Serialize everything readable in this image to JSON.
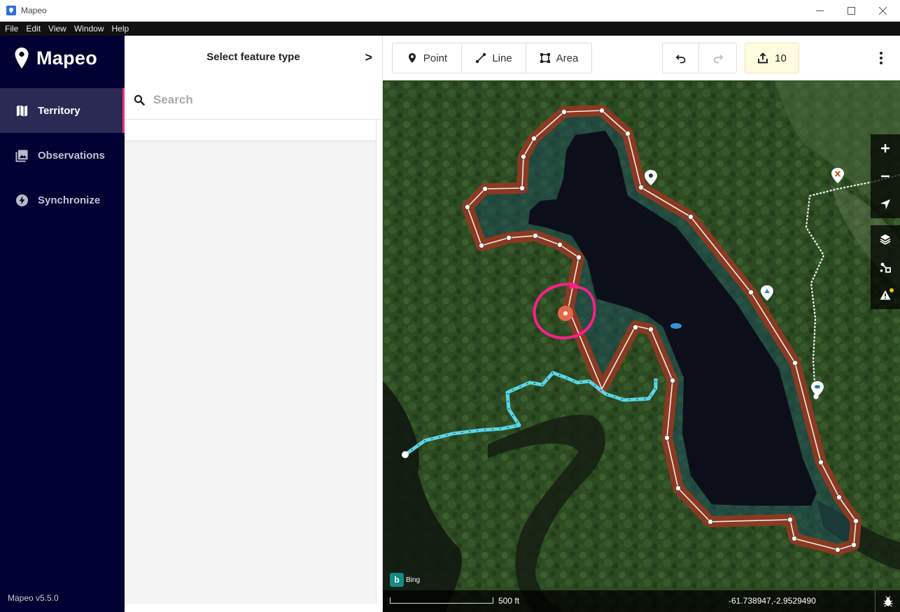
{
  "window": {
    "title": "Mapeo"
  },
  "menu": [
    "File",
    "Edit",
    "View",
    "Window",
    "Help"
  ],
  "sidebar": {
    "logo": "Mapeo",
    "items": [
      {
        "label": "Territory",
        "icon": "map-icon",
        "active": true
      },
      {
        "label": "Observations",
        "icon": "photos-icon",
        "active": false
      },
      {
        "label": "Synchronize",
        "icon": "bolt-icon",
        "active": false
      }
    ],
    "version": "Mapeo v5.5.0"
  },
  "panel": {
    "title": "Select feature type",
    "next": ">",
    "search_placeholder": "Search"
  },
  "toolbar": {
    "point": "Point",
    "line": "Line",
    "area": "Area",
    "sync_count": "10"
  },
  "map": {
    "attribution": "Bing",
    "scale_label": "500 ft",
    "coordinates": "-61.738947,-2.9529490",
    "controls": [
      "zoom-in-icon",
      "zoom-out-icon",
      "locate-icon",
      "layers-icon",
      "measure-icon",
      "issues-icon"
    ],
    "colors": {
      "area_outline": "#8a3a22",
      "area_fill": "#1c4a55",
      "water": "#0c0f1a",
      "line_highlight": "#5ad6e6",
      "vertex_selected": "#e8654a",
      "annotation_circle": "#ff1f8c"
    }
  }
}
